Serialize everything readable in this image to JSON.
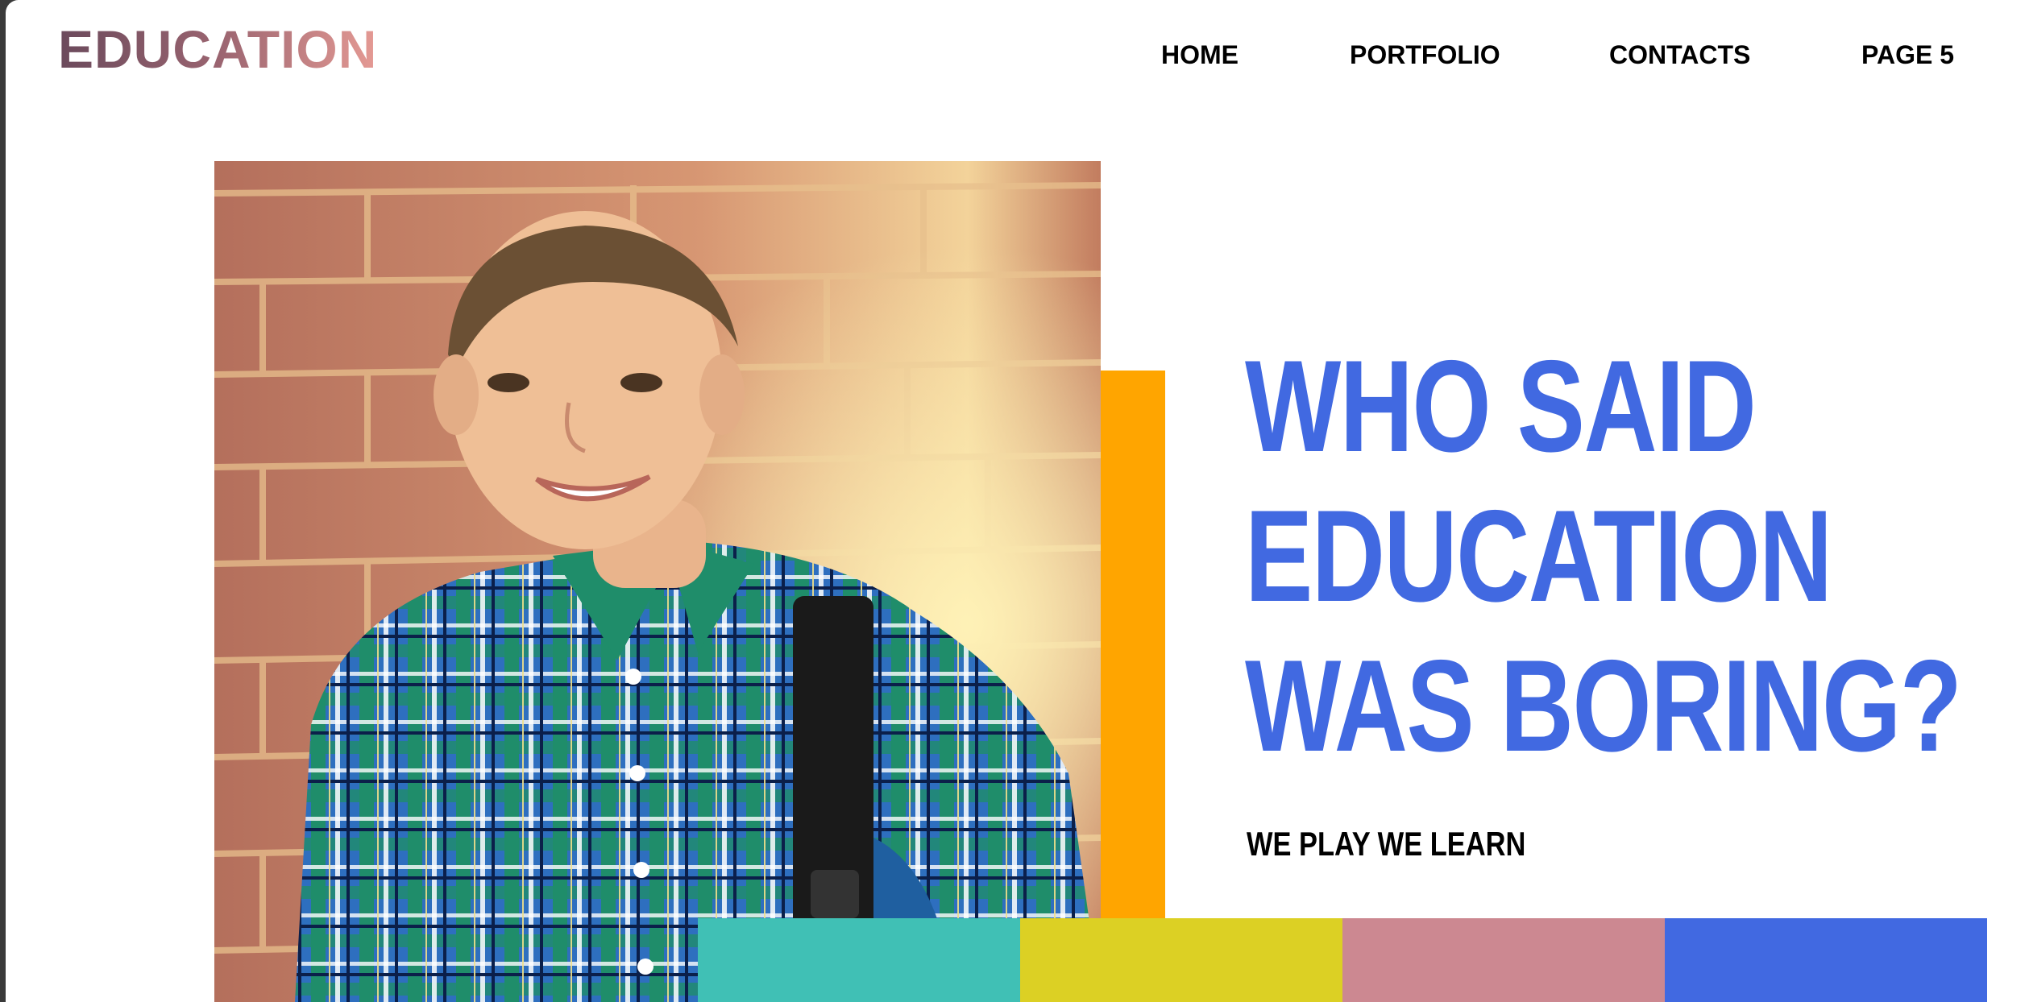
{
  "brand": {
    "logo_text": "EDUCATION"
  },
  "nav": {
    "items": [
      {
        "label": "HOME"
      },
      {
        "label": "PORTFOLIO"
      },
      {
        "label": "CONTACTS"
      },
      {
        "label": "PAGE 5"
      }
    ]
  },
  "hero": {
    "headline_lines": [
      "WHO SAID",
      "EDUCATION",
      "WAS BORING?"
    ],
    "tagline": "WE PLAY WE LEARN",
    "image_subject": "smiling boy in plaid shirt with backpack against brick wall"
  },
  "colors": {
    "headline": "#4169e1",
    "accent_bar": "#ffa500",
    "swatches": [
      "#40c0b5",
      "#dcd024",
      "#cc8891",
      "#4169e1"
    ]
  }
}
